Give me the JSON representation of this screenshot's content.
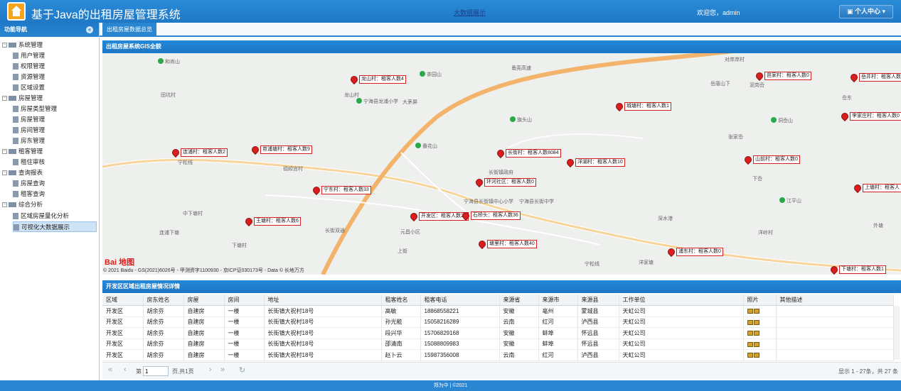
{
  "header": {
    "title": "基于Java的出租房屋管理系统",
    "bigdata_link": "大数据展示",
    "welcome": "欢迎您，admin",
    "user_center": "个人中心"
  },
  "sidebar": {
    "title": "功能导航",
    "collapse": "«",
    "items": [
      {
        "label": "系统管理",
        "level": 0
      },
      {
        "label": "用户管理",
        "level": 1
      },
      {
        "label": "权限管理",
        "level": 1
      },
      {
        "label": "资源管理",
        "level": 1
      },
      {
        "label": "区域设置",
        "level": 1
      },
      {
        "label": "房屋管理",
        "level": 0
      },
      {
        "label": "房屋类型管理",
        "level": 1
      },
      {
        "label": "房屋管理",
        "level": 1
      },
      {
        "label": "房间管理",
        "level": 1
      },
      {
        "label": "房东管理",
        "level": 1
      },
      {
        "label": "租客管理",
        "level": 0
      },
      {
        "label": "租住审核",
        "level": 1
      },
      {
        "label": "查询报表",
        "level": 0
      },
      {
        "label": "房屋查询",
        "level": 1
      },
      {
        "label": "租客查询",
        "level": 1
      },
      {
        "label": "综合分析",
        "level": 0
      },
      {
        "label": "区域房屋量化分析",
        "level": 1
      },
      {
        "label": "可视化大数据展示",
        "level": 1,
        "selected": true
      }
    ]
  },
  "tabs": [
    {
      "label": "出租房屋数据总览"
    }
  ],
  "map_panel": {
    "title": "出租房屋系统GIS全貌",
    "markers": [
      "龙山村：租客人数4",
      "邑家村：租客人数0",
      "岳井村：租客人数",
      "城塘村：租客人数1",
      "李家庄村：租客人数0",
      "连浦村：租客人数2",
      "岜浦塘村：租客人数9",
      "长街村：租客人数8084",
      "洋湖村：租客人数10",
      "山前村：租客人数0",
      "环河社区：租客人数0",
      "宁东村：租客人数33",
      "上塘村：租客人",
      "开发区：租客人数27",
      "石桥头：租客人数36",
      "王塘村：租客人数6",
      "塘里村：租客人数40",
      "浦东村：租客人数0",
      "下塘村：租客人数1"
    ],
    "pois": [
      "和尚山",
      "茶园山",
      "宁海县龙浦小学",
      "大茅屏",
      "旗头山",
      "岳唐山下",
      "泥岗岙",
      "张家岙",
      "岙东",
      "洞岙山",
      "番花山",
      "长街镇政府",
      "宁海县长街镇中心小学",
      "宁海县长街中学",
      "宁松线",
      "德顺宫村",
      "田坑村",
      "中下塘村",
      "连浦下塘",
      "长街双通",
      "元昌小区",
      "上街",
      "下塘村",
      "下岙",
      "江平山",
      "深水港",
      "洋岭村",
      "外塘",
      "洋家塘",
      "宁松线",
      "甬莞高速",
      "对岸岸村",
      "龙山村"
    ],
    "logo": "Bai 地图",
    "copyright": "© 2021 Baidu - GS(2021)6026号 - 甲测资字1100930 - 京ICP证030173号 - Data © 长地万方"
  },
  "table_panel": {
    "title": "开发区区域出租房屋情况详情",
    "columns": [
      "区域",
      "房东姓名",
      "房屋",
      "房间",
      "地址",
      "租客姓名",
      "租客电话",
      "来源省",
      "来源市",
      "来源县",
      "工作单位",
      "照片",
      "其他描述"
    ],
    "rows": [
      [
        "开发区",
        "胡余芬",
        "自建房",
        "一楼",
        "长街镇大祝村18号",
        "高敏",
        "18868558221",
        "安徽",
        "亳州",
        "蒙城县",
        "天虹公司",
        "",
        ""
      ],
      [
        "开发区",
        "胡余芬",
        "自建房",
        "一楼",
        "长街镇大祝村18号",
        "孙光能",
        "15058216289",
        "云南",
        "红河",
        "泸西县",
        "天虹公司",
        "",
        ""
      ],
      [
        "开发区",
        "胡余芬",
        "自建房",
        "一楼",
        "长街镇大祝村18号",
        "段兴华",
        "15706829168",
        "安徽",
        "蚌埠",
        "怀远县",
        "天虹公司",
        "",
        ""
      ],
      [
        "开发区",
        "胡余芬",
        "自建房",
        "一楼",
        "长街镇大祝村18号",
        "邵清南",
        "15088809983",
        "安徽",
        "蚌埠",
        "怀远县",
        "天虹公司",
        "",
        ""
      ],
      [
        "开发区",
        "胡余芬",
        "自建房",
        "一楼",
        "长街镇大祝村18号",
        "赵卜云",
        "15987356008",
        "云南",
        "红河",
        "泸西县",
        "天虹公司",
        "",
        ""
      ]
    ]
  },
  "pager": {
    "page_label": "第",
    "page_value": "1",
    "of_label": "页,共1页",
    "summary": "显示 1 - 27条，共 27 条"
  },
  "footer": {
    "text": "郑为中 | ©2021"
  },
  "colors": {
    "header": "#2a86d1",
    "marker": "#d81e1e"
  }
}
